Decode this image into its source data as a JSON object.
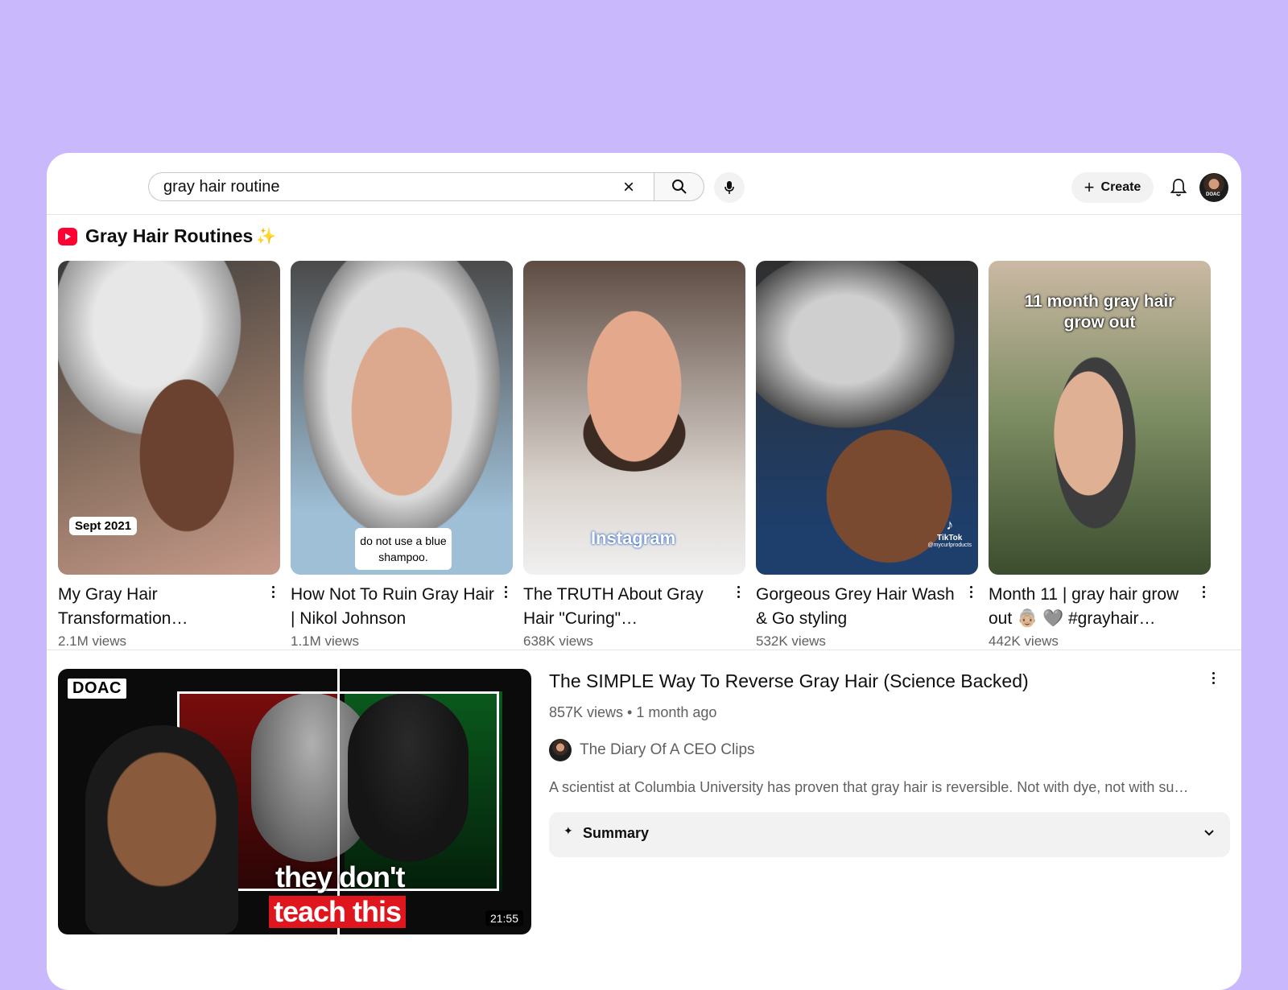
{
  "search": {
    "query": "gray hair routine",
    "clear_icon": "close-icon",
    "search_icon": "search-icon",
    "mic_icon": "mic-icon"
  },
  "header": {
    "create_label": "Create",
    "notifications_icon": "bell-icon",
    "avatar_text": "DOAC"
  },
  "shorts": {
    "title": "Gray Hair Routines",
    "sparkle": "✨",
    "items": [
      {
        "title": "My Gray Hair Transformation…",
        "views": "2.1M views",
        "overlay": "Sept 2021"
      },
      {
        "title": "How Not To Ruin Gray Hair | Nikol Johnson",
        "views": "1.1M views",
        "overlay": "do not use a blue shampoo."
      },
      {
        "title": "The TRUTH About Gray Hair \"Curing\"…",
        "views": "638K views",
        "overlay": "Instagram"
      },
      {
        "title": "Gorgeous Grey Hair Wash & Go styling",
        "views": "532K views",
        "overlay": "TikTok",
        "overlay_handle": "@mycurlproducts"
      },
      {
        "title": "Month 11 | gray hair grow out 👵🏼 🩶 #grayhair…",
        "views": "442K views",
        "overlay": "11 month gray hair grow out"
      }
    ]
  },
  "video": {
    "title": "The SIMPLE Way To Reverse Gray Hair (Science Backed)",
    "meta": "857K views • 1 month ago",
    "channel": "The Diary Of A CEO Clips",
    "description": "A scientist at Columbia University has proven that gray hair is reversible. Not with dye, not with su…",
    "summary_label": "Summary",
    "summary_spark": "✦",
    "thumb_badge": "DOAC",
    "thumb_line1": "they don't",
    "thumb_line2": "teach this",
    "duration": "21:55"
  },
  "colors": {
    "background": "#c9b8fc",
    "shorts_red": "#ff0033",
    "thumb_red": "#e0161f"
  }
}
